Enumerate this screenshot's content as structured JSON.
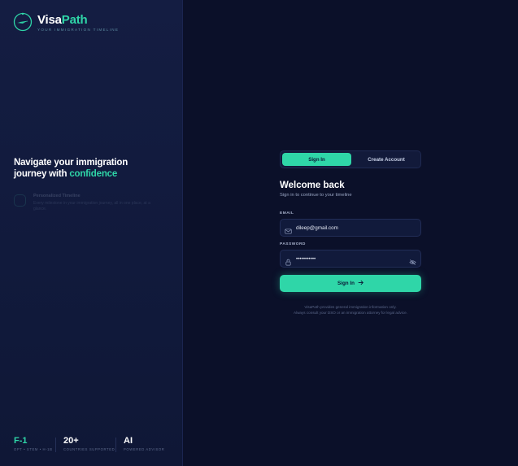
{
  "brand": {
    "name_part1": "Visa",
    "name_part2": "Path",
    "tagline": "YOUR IMMIGRATION TIMELINE"
  },
  "hero": {
    "headline_line1": "Navigate your immigration",
    "headline_line2": "journey with",
    "headline_accent": "confidence"
  },
  "feature": {
    "title": "Personalized Timeline",
    "description": "Every milestone in your immigration journey, all in one place, at a glance."
  },
  "stats": [
    {
      "value": "F-1",
      "label": "OPT • STEM • H-1B"
    },
    {
      "value": "20+",
      "label": "COUNTRIES SUPPORTED"
    },
    {
      "value": "AI",
      "label": "POWERED ADVISOR"
    }
  ],
  "auth": {
    "tabs": [
      {
        "label": "Sign In",
        "active": true
      },
      {
        "label": "Create Account",
        "active": false
      }
    ],
    "title": "Welcome back",
    "subtitle": "Sign in to continue to your timeline",
    "email_label": "EMAIL",
    "email_value": "dileep@gmail.com",
    "password_label": "PASSWORD",
    "password_value": "•••••••••••",
    "submit_label": "Sign In",
    "disclaimer_line1": "VisaPath provides general immigration information only.",
    "disclaimer_line2": "Always consult your DSO or an immigration attorney for legal advice."
  },
  "icons": {
    "logo": "compass-plane-icon",
    "email": "mail-icon",
    "password": "lock-icon",
    "toggle_visibility": "eye-off-icon",
    "submit_arrow": "arrow-right-icon",
    "feature": "timeline-icon"
  },
  "colors": {
    "accent": "#2fd6a8",
    "background": "#0b1029",
    "panel": "#141d42"
  }
}
